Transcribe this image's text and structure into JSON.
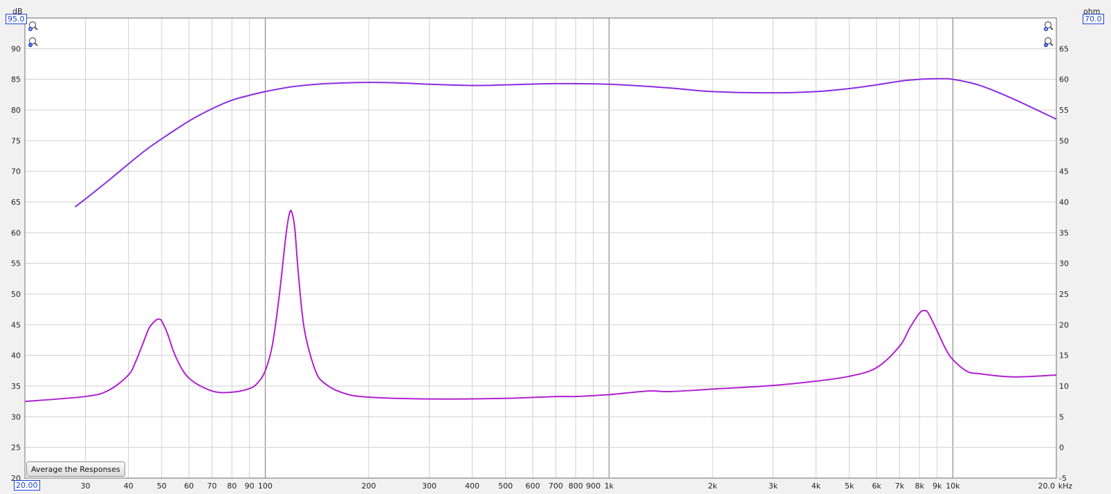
{
  "left_unit": "dB",
  "right_unit": "ohm",
  "x_unit": "kHz",
  "left_top_value": "95.0",
  "right_top_value": "70.0",
  "x_start_value": "20.00",
  "average_button_label": "Average the Responses",
  "icons": [
    "zoom-in-icon",
    "zoom-out-icon"
  ],
  "colors": {
    "spl_curve": "#8a2be2",
    "impedance_curve": "#b01fd0",
    "range_box": "#1a3fd0"
  },
  "chart_data": {
    "type": "line",
    "x_scale": "log",
    "xlim": [
      20,
      20000
    ],
    "ylim_left": [
      20,
      95
    ],
    "ylim_right": [
      -5,
      70
    ],
    "grid": true,
    "x_ticks": [
      {
        "v": 30,
        "label": "30"
      },
      {
        "v": 40,
        "label": "40"
      },
      {
        "v": 50,
        "label": "50"
      },
      {
        "v": 60,
        "label": "60"
      },
      {
        "v": 70,
        "label": "70"
      },
      {
        "v": 80,
        "label": "80"
      },
      {
        "v": 90,
        "label": "90"
      },
      {
        "v": 100,
        "label": "100"
      },
      {
        "v": 200,
        "label": "200"
      },
      {
        "v": 300,
        "label": "300"
      },
      {
        "v": 400,
        "label": "400"
      },
      {
        "v": 500,
        "label": "500"
      },
      {
        "v": 600,
        "label": "600"
      },
      {
        "v": 700,
        "label": "700"
      },
      {
        "v": 800,
        "label": "800"
      },
      {
        "v": 900,
        "label": "900"
      },
      {
        "v": 1000,
        "label": "1k"
      },
      {
        "v": 2000,
        "label": "2k"
      },
      {
        "v": 3000,
        "label": "3k"
      },
      {
        "v": 4000,
        "label": "4k"
      },
      {
        "v": 5000,
        "label": "5k"
      },
      {
        "v": 6000,
        "label": "6k"
      },
      {
        "v": 7000,
        "label": "7k"
      },
      {
        "v": 8000,
        "label": "8k"
      },
      {
        "v": 9000,
        "label": "9k"
      },
      {
        "v": 10000,
        "label": "10k"
      },
      {
        "v": 20000,
        "label": "20.0"
      }
    ],
    "y_ticks_left": [
      25,
      30,
      35,
      40,
      45,
      50,
      55,
      60,
      65,
      70,
      75,
      80,
      85,
      90
    ],
    "y_ticks_right": [
      0,
      5,
      10,
      15,
      20,
      25,
      30,
      35,
      40,
      45,
      50,
      55,
      60,
      65
    ],
    "bottom_left_label": "20",
    "bottom_right_label": "-5",
    "series": [
      {
        "axis": "left",
        "x": [
          28,
          30,
          35,
          40,
          45,
          50,
          60,
          70,
          80,
          90,
          100,
          120,
          150,
          200,
          250,
          300,
          400,
          500,
          700,
          1000,
          1500,
          2000,
          3000,
          4000,
          5000,
          6000,
          7000,
          8000,
          9000,
          10000,
          12000,
          15000,
          20000
        ],
        "y": [
          64.2,
          65.5,
          68.5,
          71.2,
          73.5,
          75.3,
          78.2,
          80.2,
          81.6,
          82.4,
          83.0,
          83.8,
          84.3,
          84.5,
          84.4,
          84.2,
          84.0,
          84.1,
          84.3,
          84.2,
          83.6,
          83.0,
          82.8,
          83.0,
          83.5,
          84.1,
          84.7,
          85.0,
          85.1,
          85.0,
          84.0,
          81.8,
          78.5
        ]
      },
      {
        "axis": "right",
        "x": [
          20,
          30,
          35,
          40,
          42,
          44,
          46,
          48,
          49,
          50,
          52,
          55,
          60,
          70,
          80,
          90,
          95,
          100,
          105,
          110,
          115,
          118,
          120,
          122,
          125,
          130,
          140,
          150,
          170,
          200,
          300,
          500,
          700,
          800,
          1000,
          1300,
          1500,
          2000,
          3000,
          4000,
          5000,
          6000,
          7000,
          7500,
          8000,
          8300,
          8500,
          9000,
          9500,
          10000,
          11000,
          12000,
          15000,
          20000
        ],
        "y": [
          7.5,
          8.3,
          9.3,
          11.8,
          14.0,
          16.8,
          19.5,
          20.7,
          20.9,
          20.6,
          18.5,
          14.7,
          11.3,
          9.2,
          9.0,
          9.6,
          10.5,
          12.5,
          16.8,
          25.0,
          34.8,
          38.4,
          38.0,
          35.5,
          28.0,
          19.2,
          12.5,
          10.3,
          8.8,
          8.2,
          7.9,
          8.0,
          8.3,
          8.3,
          8.6,
          9.2,
          9.1,
          9.5,
          10.1,
          10.8,
          11.6,
          13.0,
          16.5,
          19.5,
          21.9,
          22.3,
          21.8,
          19.0,
          16.2,
          14.3,
          12.4,
          12.0,
          11.5,
          11.8
        ]
      }
    ]
  }
}
